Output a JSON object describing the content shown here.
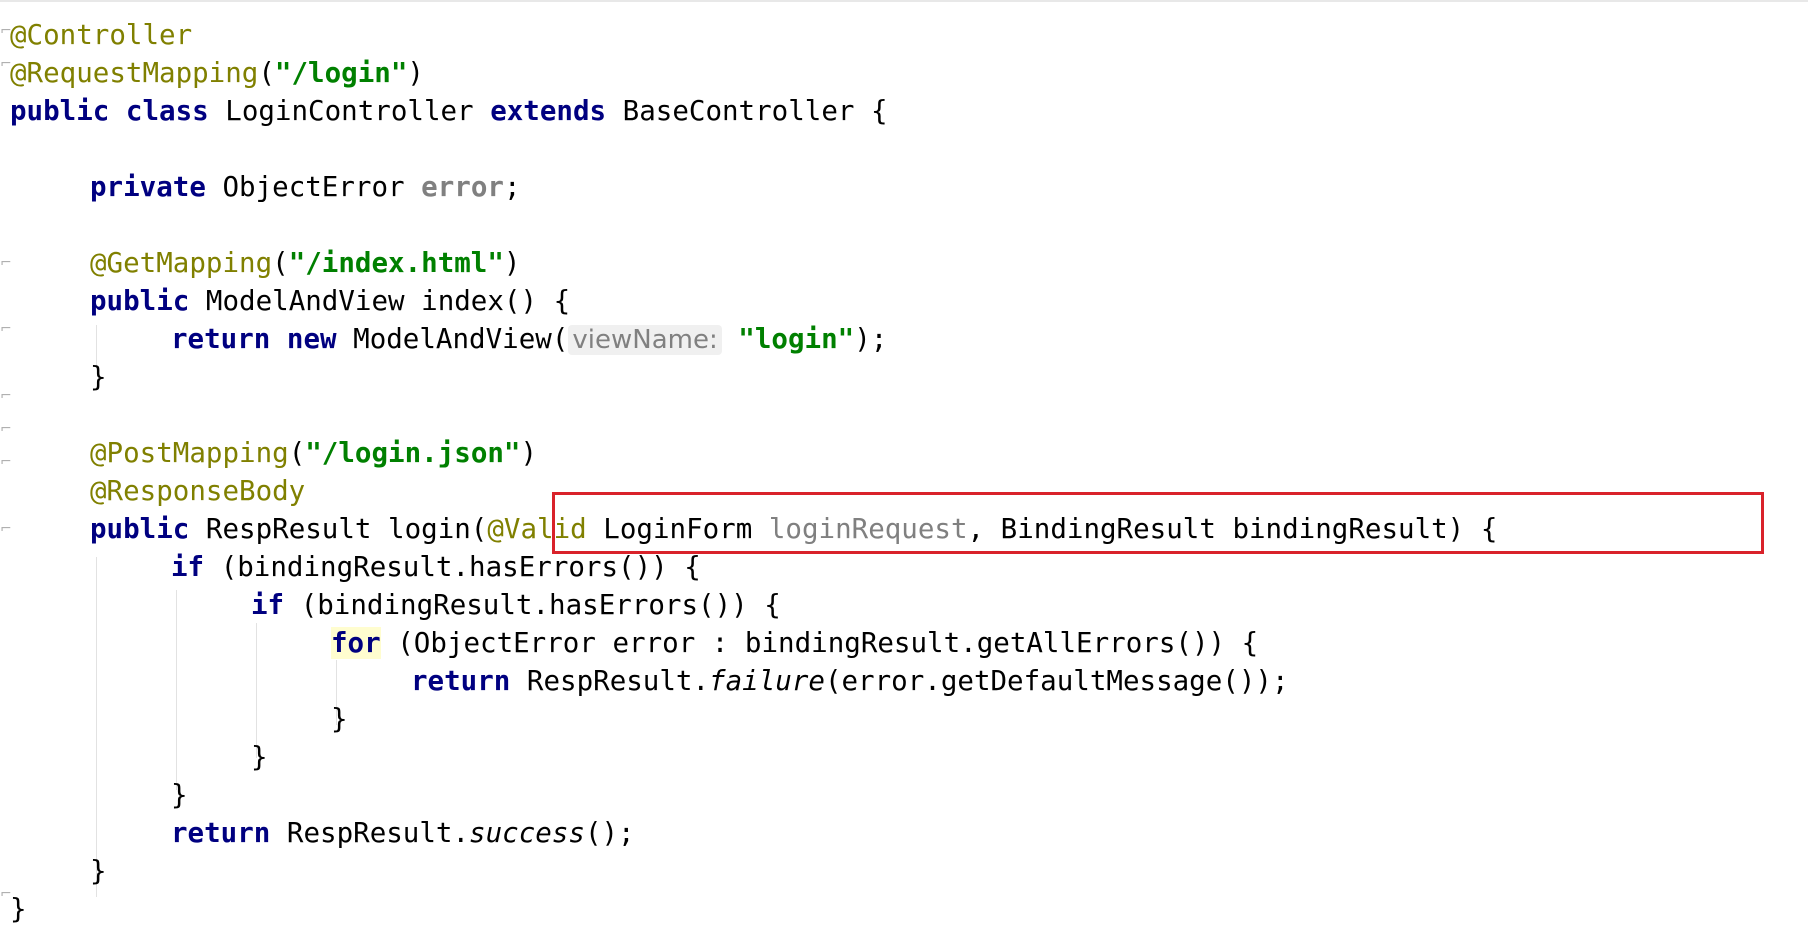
{
  "editor": {
    "accent_colors": {
      "keyword": "#000080",
      "annotation": "#808000",
      "string": "#008000",
      "field": "#660e7a",
      "highlight_box": "#d9222a"
    },
    "code": {
      "l1_ann": "@Controller",
      "l2_ann": "@RequestMapping",
      "l2_open": "(",
      "l2_str": "\"/login\"",
      "l2_close": ")",
      "l3_kw1": "public",
      "l3_kw2": "class",
      "l3_name": "LoginController",
      "l3_kw3": "extends",
      "l3_base": "BaseController {",
      "l5_kw": "private",
      "l5_type": "ObjectError",
      "l5_field": "error",
      "l5_end": ";",
      "l7_ann": "@GetMapping",
      "l7_open": "(",
      "l7_str": "\"/index.html\"",
      "l7_close": ")",
      "l8_kw": "public",
      "l8_rest": "ModelAndView index() {",
      "l9_kw1": "return",
      "l9_kw2": "new",
      "l9_type": "ModelAndView(",
      "l9_hint": "viewName:",
      "l9_str": "\"login\"",
      "l9_end": ");",
      "l10_brace": "}",
      "l12_ann": "@PostMapping",
      "l12_open": "(",
      "l12_str": "\"/login.json\"",
      "l12_close": ")",
      "l13_ann": "@ResponseBody",
      "l14_kw": "public",
      "l14_mid": "RespResult login(",
      "l14_ann": "@Valid",
      "l14_type": "LoginForm",
      "l14_param": "loginRequest",
      "l14_rest": ", BindingResult bindingResult)",
      "l14_brace": "{",
      "l15_kw": "if",
      "l15_rest": "(bindingResult.hasErrors()) {",
      "l16_kw": "if",
      "l16_rest": "(bindingResult.hasErrors()) {",
      "l17_kw": "for",
      "l17_rest": "(ObjectError error : bindingResult.getAllErrors()) {",
      "l18_kw": "return",
      "l18_cls": "RespResult.",
      "l18_method": "failure",
      "l18_rest": "(error.getDefaultMessage());",
      "l19_brace": "}",
      "l20_brace": "}",
      "l21_brace": "}",
      "l22_kw": "return",
      "l22_cls": "RespResult.",
      "l22_method": "success",
      "l22_rest": "();",
      "l23_brace": "}",
      "l24_brace": "}"
    }
  }
}
